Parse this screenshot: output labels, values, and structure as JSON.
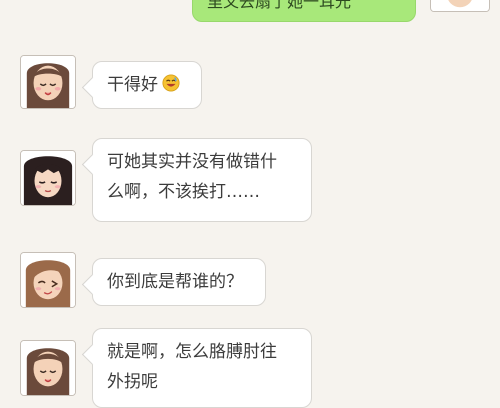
{
  "conversation": {
    "top_message": {
      "text": "里又去扇了她一耳光"
    },
    "messages": [
      {
        "text": "干得好",
        "emoji": "laughing-emoji"
      },
      {
        "line1": "可她其实并没有做错什",
        "line2": "么啊，不该挨打……"
      },
      {
        "text": "你到底是帮谁的？"
      },
      {
        "line1": "就是啊，怎么胳膊肘往",
        "line2": "外拐呢"
      }
    ]
  },
  "avatars": {
    "top_right": "avatar-partial",
    "a1": "avatar-long-hair-girl",
    "a2": "avatar-black-hair-girl",
    "a3": "avatar-winking-girl",
    "a4": "avatar-long-hair-girl"
  },
  "colors": {
    "background": "#f6f3ee",
    "bubble_white": "#ffffff",
    "bubble_green": "#a8e87a",
    "text": "#3c3c3c"
  }
}
